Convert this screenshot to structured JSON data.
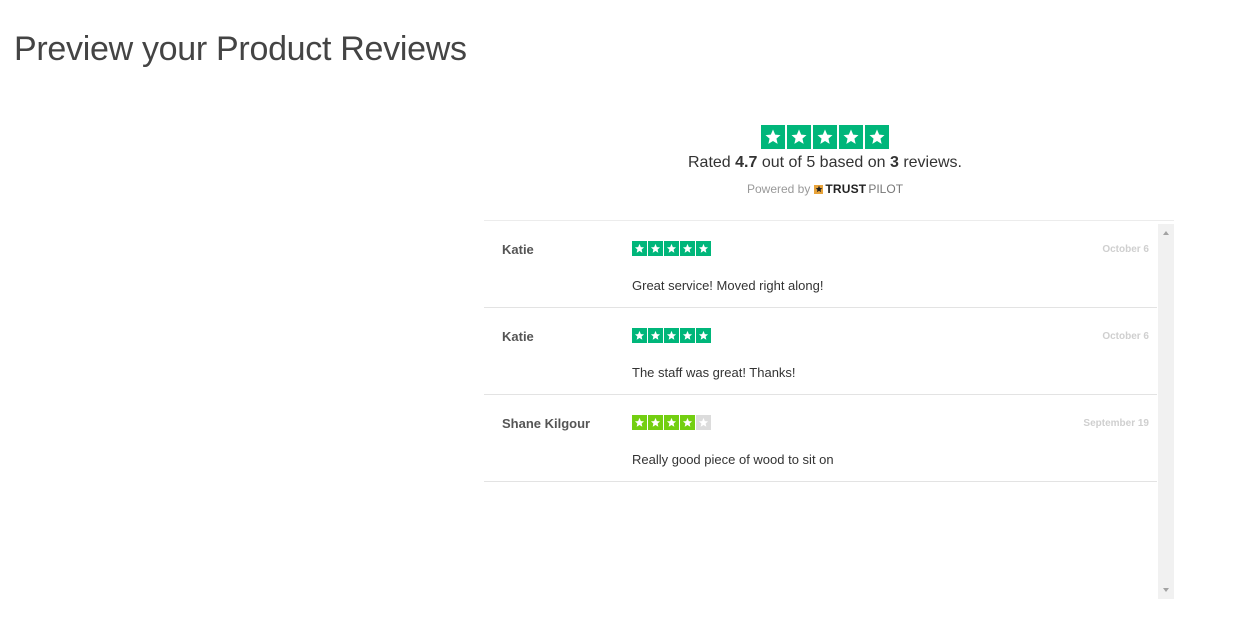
{
  "page": {
    "title": "Preview your Product Reviews"
  },
  "summary": {
    "rating_prefix": "Rated",
    "rating": "4.7",
    "rating_mid": "out of 5 based on",
    "review_count": "3",
    "rating_suffix": "reviews.",
    "stars": 5,
    "powered_by": "Powered by",
    "brand_bold": "TRUST",
    "brand_light": "PILOT"
  },
  "reviews": [
    {
      "name": "Katie",
      "stars": 5,
      "date": "October 6",
      "text": "Great service! Moved right along!"
    },
    {
      "name": "Katie",
      "stars": 5,
      "date": "October 6",
      "text": "The staff was great! Thanks!"
    },
    {
      "name": "Shane Kilgour",
      "stars": 4,
      "date": "September 19",
      "text": "Really good piece of wood to sit on"
    }
  ],
  "icons": {
    "star": "star-icon",
    "scroll_up": "scroll-up-icon",
    "scroll_down": "scroll-down-icon",
    "logo": "trustpilot-logo-icon"
  },
  "colors": {
    "five_star": "#00b67a",
    "four_star": "#73cf11",
    "empty_star": "#dcdcdc"
  }
}
